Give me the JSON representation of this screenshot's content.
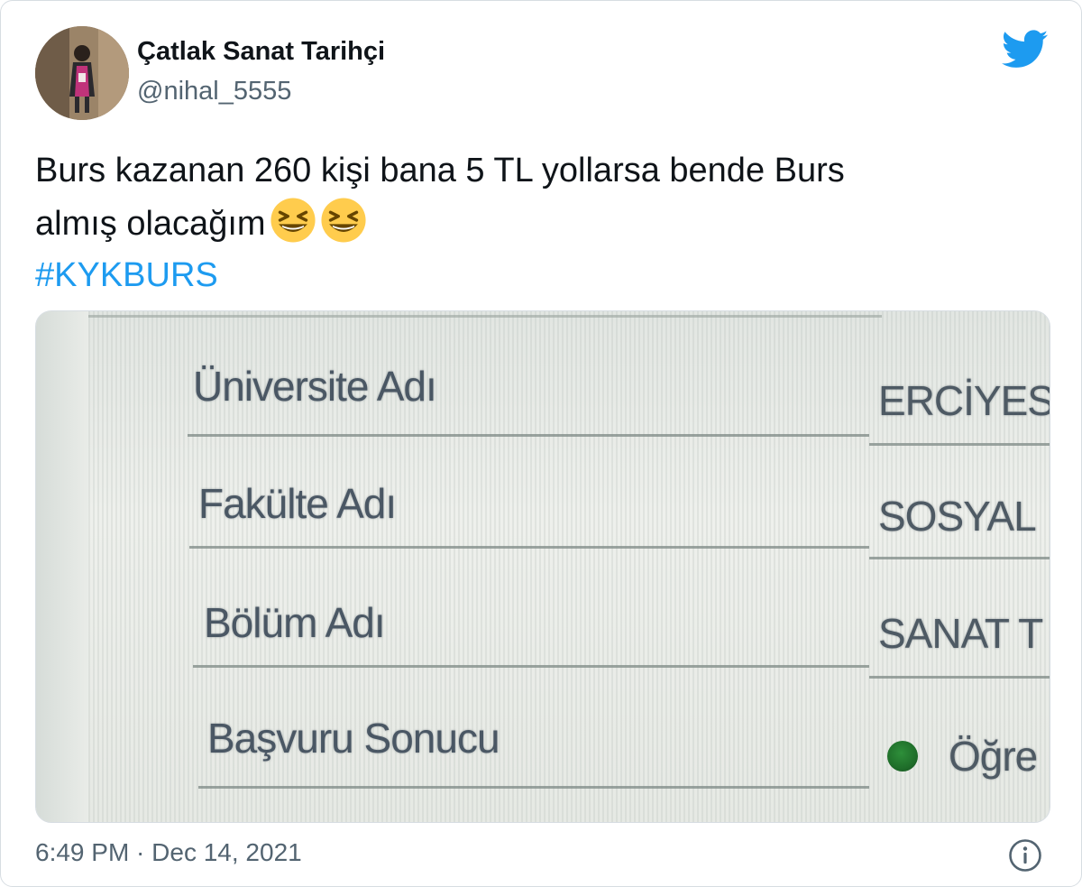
{
  "user": {
    "display_name": "Çatlak Sanat Tarihçi",
    "handle": "@nihal_5555",
    "avatar_icon": "profile-photo"
  },
  "brand": {
    "icon": "twitter-bird-icon",
    "color": "#1d9bf0"
  },
  "tweet": {
    "line1": "Burs kazanan 260 kişi bana 5 TL yollarsa bende Burs",
    "line2": "almış olacağım",
    "emoji": [
      "grinning-squinting-face",
      "grinning-squinting-face"
    ],
    "hashtag": "#KYKBURS"
  },
  "media": {
    "rows": [
      {
        "label": "Üniversite Adı",
        "value": "ERCİYES"
      },
      {
        "label": "Fakülte Adı",
        "value": "SOSYAL"
      },
      {
        "label": "Bölüm Adı",
        "value": "SANAT T"
      },
      {
        "label": "Başvuru Sonucu",
        "value": "Öğre"
      }
    ],
    "status_color": "#1f6e2a"
  },
  "footer": {
    "timestamp": "6:49 PM · Dec 14, 2021",
    "info_icon": "info-icon"
  }
}
